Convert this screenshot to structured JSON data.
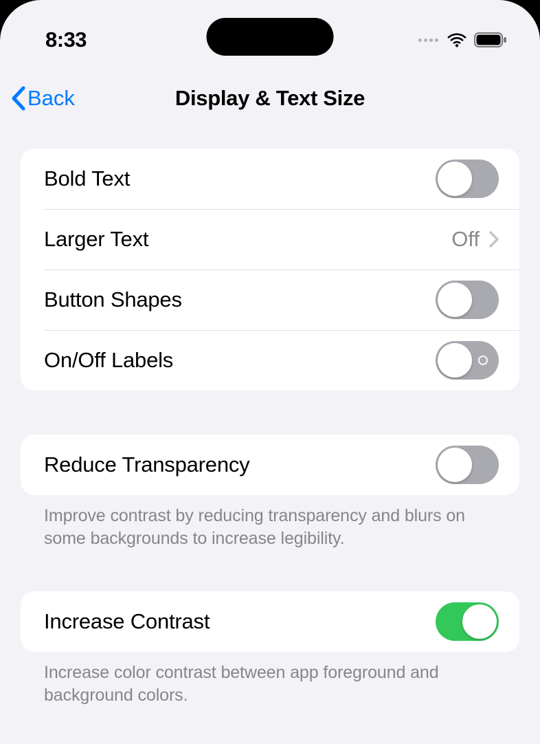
{
  "statusBar": {
    "time": "8:33"
  },
  "nav": {
    "backLabel": "Back",
    "title": "Display & Text Size"
  },
  "group1": {
    "boldText": {
      "label": "Bold Text",
      "on": false
    },
    "largerText": {
      "label": "Larger Text",
      "value": "Off"
    },
    "buttonShapes": {
      "label": "Button Shapes",
      "on": false
    },
    "onOffLabels": {
      "label": "On/Off Labels",
      "on": false,
      "showIndicator": true
    }
  },
  "group2": {
    "reduceTransparency": {
      "label": "Reduce Transparency",
      "on": false
    },
    "footer": "Improve contrast by reducing transparency and blurs on some backgrounds to increase legibility."
  },
  "group3": {
    "increaseContrast": {
      "label": "Increase Contrast",
      "on": true
    },
    "footer": "Increase color contrast between app foreground and background colors."
  }
}
